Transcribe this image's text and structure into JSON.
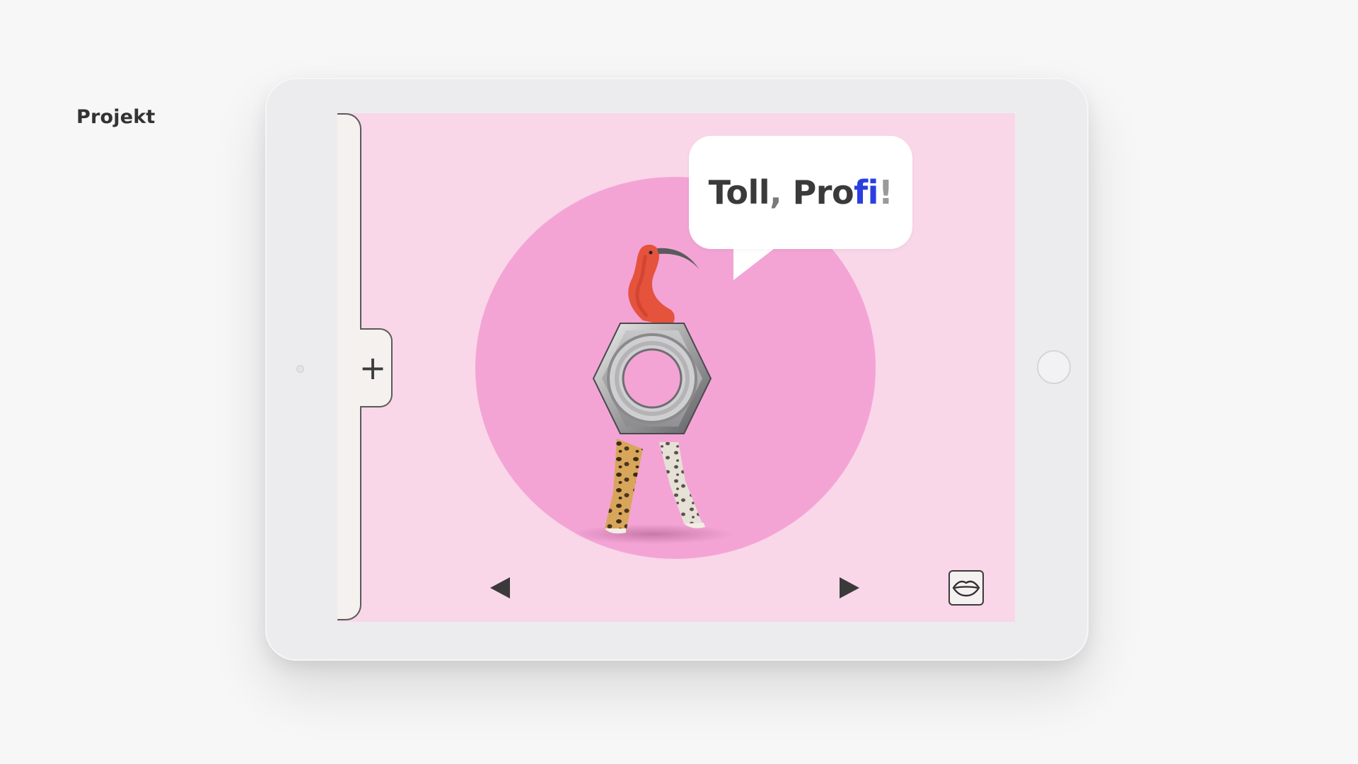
{
  "page": {
    "label": "Projekt"
  },
  "app": {
    "add_button_label": "+",
    "speech_bubble": {
      "word1": "Toll",
      "comma": ",",
      "word2_start": "Pro",
      "word2_highlight": "fi",
      "exclamation": "!"
    },
    "controls": {
      "previous_icon": "triangle-left-icon",
      "next_icon": "triangle-right-icon",
      "speak_icon": "lips-icon"
    }
  },
  "colors": {
    "background": "#f7f7f8",
    "tablet_frame": "#ececee",
    "screen_background": "#f9d6e8",
    "circle": "#f3a4d5",
    "side_panel": "#f5f1ee",
    "text_dark": "#3a3a3a",
    "highlight_blue": "#2a3fe0"
  }
}
